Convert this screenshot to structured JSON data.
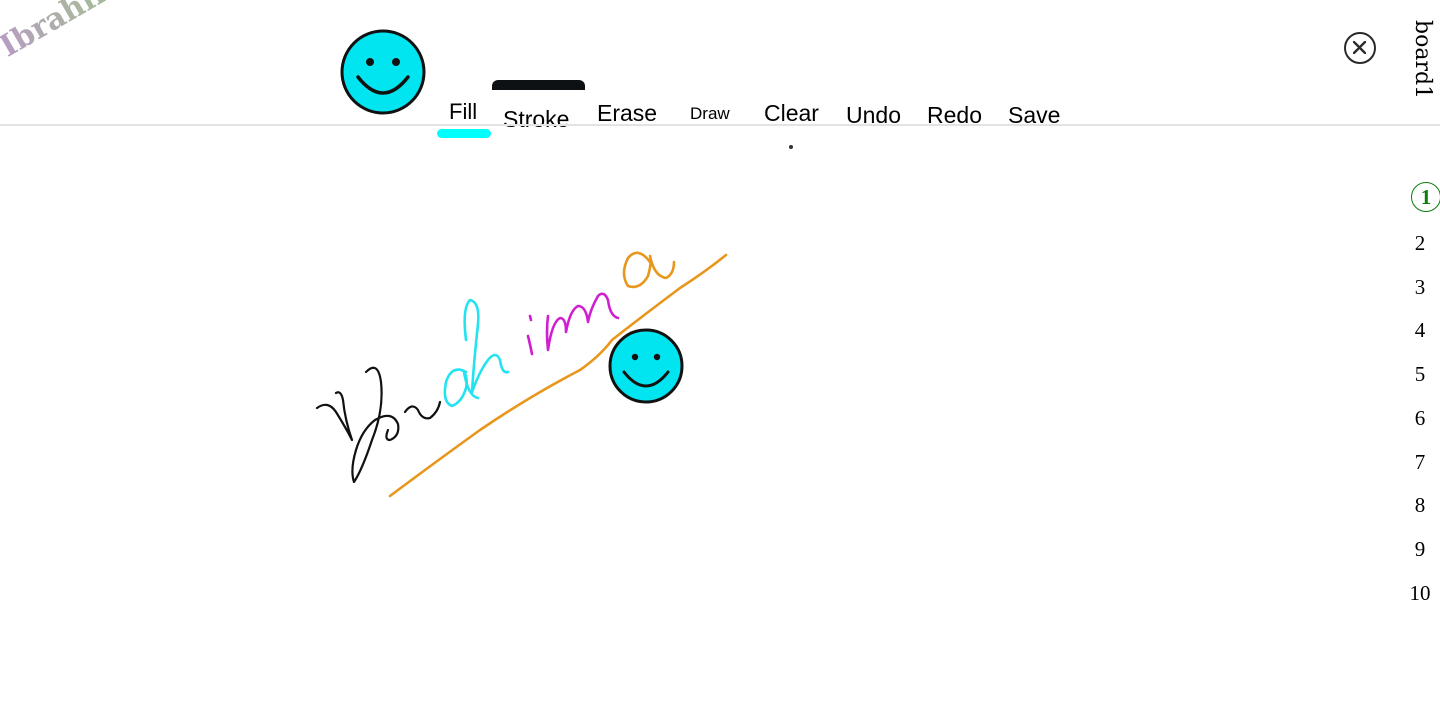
{
  "logo": {
    "text": "Ibrahima"
  },
  "toolbar": {
    "fill_label": "Fill",
    "stroke_label": "Stroke",
    "erase_label": "Erase",
    "draw_label": "Draw",
    "clear_label": "Clear",
    "undo_label": "Undo",
    "redo_label": "Redo",
    "save_label": "Save",
    "fill_color": "#00ffff",
    "stroke_color": "#0e1114",
    "smiley_icon": "smiley-face-icon"
  },
  "board": {
    "title": "board1",
    "close_icon": "close-icon"
  },
  "pages": {
    "items": [
      "1",
      "2",
      "3",
      "4",
      "5",
      "6",
      "7",
      "8",
      "9",
      "10"
    ],
    "active": "1"
  },
  "canvas": {
    "stroke_colors": {
      "letters_I_b_r": "#111111",
      "letters_a_h": "#22e3f0",
      "letters_i_m": "#d01fd0",
      "letter_a_last": "#e8961c",
      "underline": "#e8961c"
    },
    "stamp": "smiley-face-icon"
  }
}
